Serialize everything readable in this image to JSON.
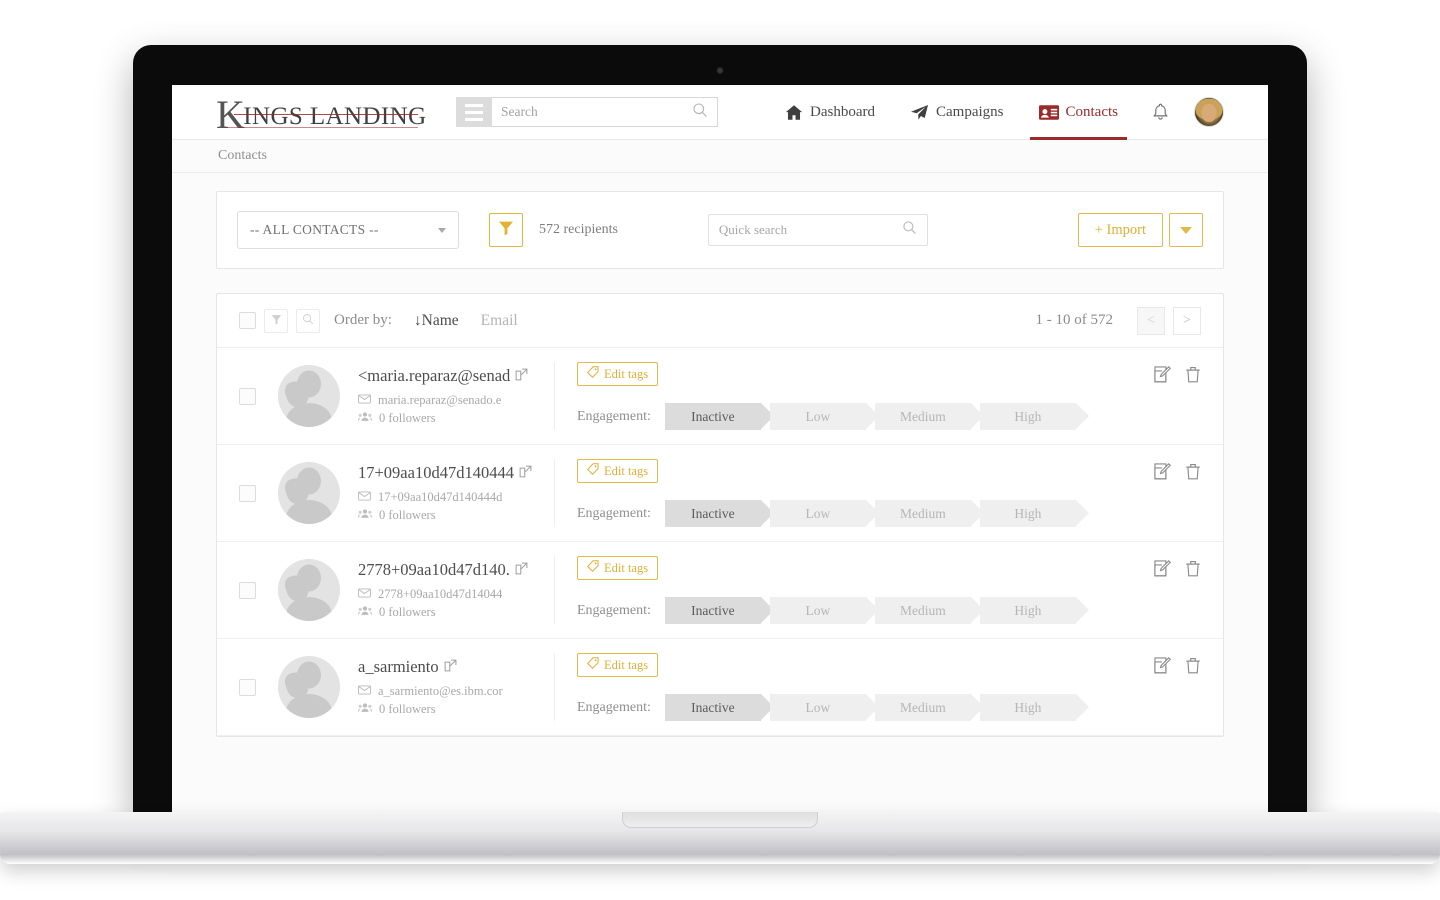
{
  "brand": {
    "k": "K",
    "rest": "INGS LANDING"
  },
  "header": {
    "menu_icon": "hamburger-icon",
    "search_placeholder": "Search",
    "search_value": "",
    "nav": [
      {
        "label": "Dashboard",
        "icon": "home-icon",
        "active": false
      },
      {
        "label": "Campaigns",
        "icon": "paper-plane-icon",
        "active": false
      },
      {
        "label": "Contacts",
        "icon": "id-card-icon",
        "active": true
      }
    ],
    "bell_icon": "bell-icon",
    "avatar": "user-avatar"
  },
  "breadcrumb": {
    "label": "Contacts"
  },
  "toolbar": {
    "list_select": "-- ALL CONTACTS --",
    "filter_icon": "funnel-icon",
    "recipients": "572 recipients",
    "quick_search_placeholder": "Quick search",
    "quick_search_value": "",
    "import_label": "+ Import",
    "import_caret": "chevron-down-icon"
  },
  "list_header": {
    "select_all": "select-all-checkbox",
    "filter_icon": "funnel-icon",
    "search_icon": "search-icon",
    "order_by_label": "Order by:",
    "order_options": [
      {
        "label": "↓Name",
        "active": true
      },
      {
        "label": "Email",
        "active": false
      }
    ],
    "pagination": {
      "count": "1 - 10 of 572",
      "prev": "<",
      "next": ">"
    }
  },
  "engagement": {
    "label": "Engagement:",
    "levels": [
      "Inactive",
      "Low",
      "Medium",
      "High"
    ],
    "active_index": 0
  },
  "row_common": {
    "edit_tags_label": "Edit tags",
    "tag_icon": "tag-icon",
    "external_link_icon": "external-link-icon",
    "email_icon": "envelope-icon",
    "followers_icon": "users-icon",
    "edit_icon": "edit-icon",
    "delete_icon": "trash-icon"
  },
  "contacts": [
    {
      "name": "<maria.reparaz@senad",
      "email": "maria.reparaz@senado.e",
      "followers": "0 followers"
    },
    {
      "name": "17+09aa10d47d140444",
      "email": "17+09aa10d47d140444d",
      "followers": "0 followers"
    },
    {
      "name": "2778+09aa10d47d140.",
      "email": "2778+09aa10d47d14044",
      "followers": "0 followers"
    },
    {
      "name": "a_sarmiento",
      "email": "a_sarmiento@es.ibm.cor",
      "followers": "0 followers"
    }
  ],
  "colors": {
    "accent_gold": "#e3b94a",
    "brand_red": "#9b2b2b",
    "text_dark": "#4a4a4a",
    "text_muted": "#a8a8a8"
  }
}
